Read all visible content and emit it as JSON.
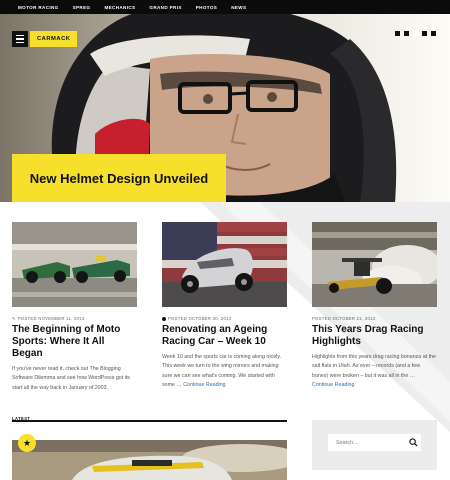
{
  "nav": {
    "items": [
      "Motor Racing",
      "Spreg",
      "Mechanics",
      "Grand Prix",
      "Photos",
      "News"
    ]
  },
  "brand": "CARMACK",
  "slider": {
    "title": "New Helmet Design Unveiled",
    "dot_count": 5,
    "active_dot": 2
  },
  "posts": [
    {
      "meta": "Posted November 11, 2013",
      "meta_icon": "pin-icon",
      "title": "The Beginning of Moto Sports: Where It All Began",
      "excerpt": "If you've never read it, check out The Blogging Software Dilemma and see how WordPress got its start all the way back in January of 2003.",
      "more": ""
    },
    {
      "meta": "Posted October 30, 2013",
      "meta_icon": "dot-icon",
      "title": "Renovating an Ageing Racing Car – Week 10",
      "excerpt": "Week 10 and the sports car is coming along nicely. This week we turn to the wing mirrors and making sure we can see what's coming. We started with some …",
      "more": "Continue Reading"
    },
    {
      "meta": "Posted October 21, 2013",
      "meta_icon": "",
      "title": "This Years Drag Racing Highlights",
      "excerpt": "Highlights from this years drag racing bonanza at the salt flats in Utah. As ever – records (and a few bones) were broken – but it was all in the …",
      "more": "Continue Reading"
    }
  ],
  "latest": {
    "label": "Latest",
    "badge_icon": "star-icon"
  },
  "search": {
    "placeholder": "Search...",
    "icon": "search-icon"
  },
  "colors": {
    "accent": "#f7e02c",
    "nav_bg": "#0b0b0b",
    "link": "#2a6db0"
  }
}
